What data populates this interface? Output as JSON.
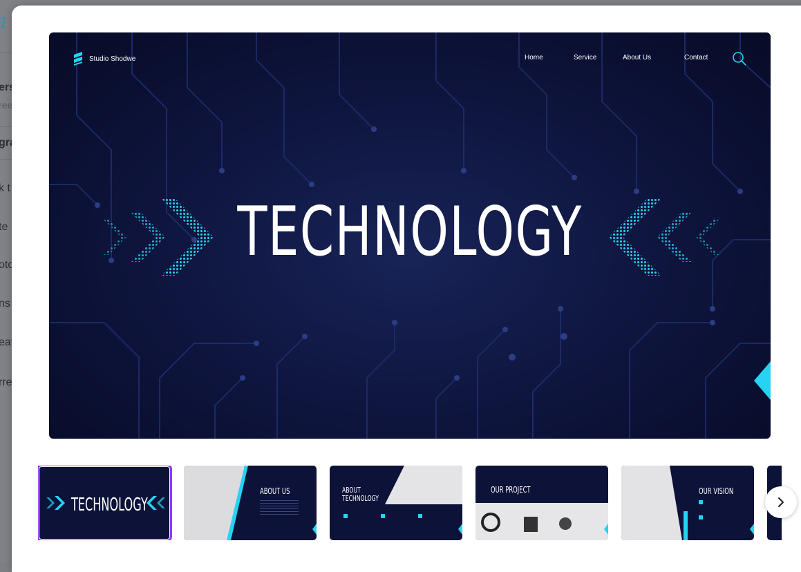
{
  "background_page": {
    "logo_fragment": "a",
    "rows": [
      {
        "text": "ers",
        "style": "bold"
      },
      {
        "text": "ree",
        "style": "small"
      },
      {
        "text": "gra",
        "style": "bold"
      },
      {
        "text": "k t",
        "style": "normal"
      },
      {
        "text": "te",
        "style": "normal"
      },
      {
        "text": "oto",
        "style": "normal"
      },
      {
        "text": "ns",
        "style": "normal"
      },
      {
        "text": "eat",
        "style": "normal"
      },
      {
        "text": "rre",
        "style": "normal"
      }
    ]
  },
  "slide": {
    "brand": "Studio Shodwe",
    "nav": [
      "Home",
      "Service",
      "About Us",
      "Contact"
    ],
    "title": "TECHNOLOGY",
    "colors": {
      "background": "#0f1640",
      "accent": "#27d3f2",
      "text": "#ffffff"
    }
  },
  "thumbnails": [
    {
      "label": "TECHNOLOGY",
      "selected": true
    },
    {
      "label": "ABOUT US",
      "selected": false
    },
    {
      "label": "ABOUT TECHNOLOGY",
      "selected": false
    },
    {
      "label": "OUR PROJECT",
      "selected": false
    },
    {
      "label": "OUR VISION",
      "selected": false
    },
    {
      "label": "",
      "selected": false
    }
  ],
  "controls": {
    "next_icon": "chevron-right-icon"
  }
}
